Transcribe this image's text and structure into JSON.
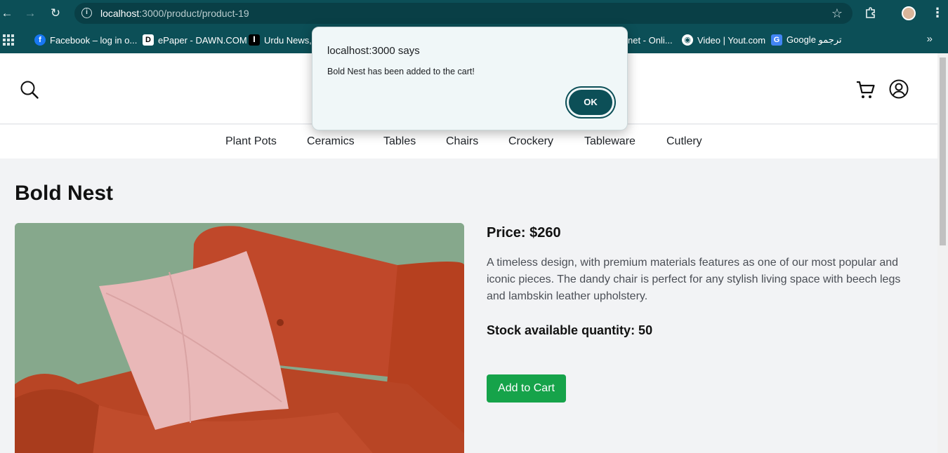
{
  "browser": {
    "url_host": "localhost",
    "url_rest": ":3000/product/product-19",
    "bookmarks": [
      {
        "label": "Facebook – log in o...",
        "icon": "f",
        "color": "#1877f2"
      },
      {
        "label": "ePaper - DAWN.COM",
        "icon": "D",
        "color": "#ffffff"
      },
      {
        "label": "Urdu News, I",
        "icon": "ا",
        "color": "#000000"
      },
      {
        "label": "net - Onli...",
        "icon": "",
        "color": ""
      },
      {
        "label": "Video | Yout.com",
        "icon": "◉",
        "color": "#ffffff"
      },
      {
        "label": "Google ترجمو",
        "icon": "G",
        "color": "#4285f4"
      }
    ]
  },
  "site": {
    "categories": [
      "Plant Pots",
      "Ceramics",
      "Tables",
      "Chairs",
      "Crockery",
      "Tableware",
      "Cutlery"
    ]
  },
  "product": {
    "title": "Bold Nest",
    "price": "Price: $260",
    "description": "A timeless design, with premium materials features as one of our most popular and iconic pieces. The dandy chair is perfect for any stylish living space with beech legs and lambskin leather upholstery.",
    "stock": "Stock available quantity: 50",
    "add_to_cart": "Add to Cart"
  },
  "dialog": {
    "title": "localhost:3000 says",
    "message": "Bold Nest has been added to the cart!",
    "ok": "OK"
  },
  "colors": {
    "chrome": "#0c4f57",
    "add_button": "#16a34a",
    "sofa": "#c0482a",
    "pillow": "#e9b8b8",
    "wall": "#86a88c"
  }
}
